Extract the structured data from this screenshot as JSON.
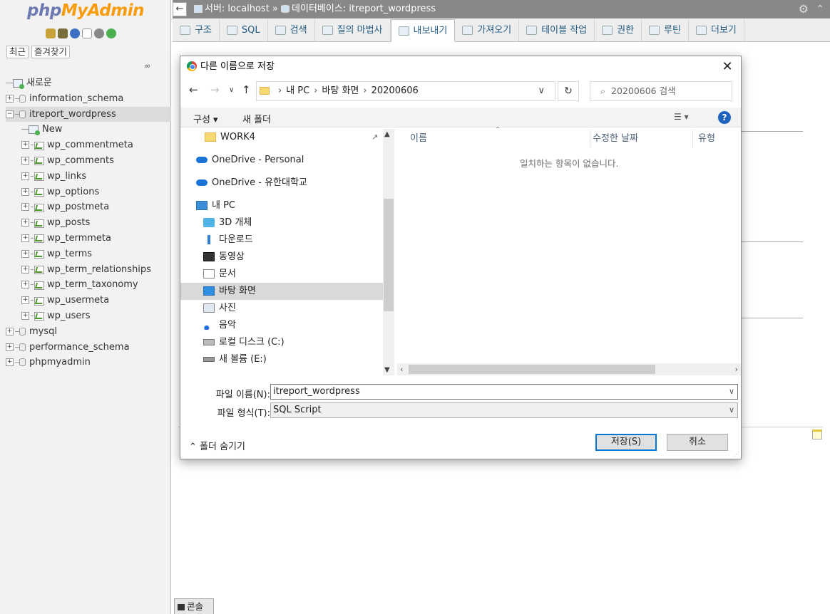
{
  "app": {
    "logo_part1": "php",
    "logo_part2": "MyAdmin",
    "nav_tabs": [
      "최근",
      "즐겨찾기"
    ],
    "nav_icons": [
      "home-icon",
      "exit-icon",
      "help-icon",
      "docs-icon",
      "settings-icon",
      "reload-icon"
    ]
  },
  "tree": {
    "new_label": "새로운",
    "databases_top": [
      "information_schema"
    ],
    "active_db": "itreport_wordpress",
    "active_new": "New",
    "tables": [
      "wp_commentmeta",
      "wp_comments",
      "wp_links",
      "wp_options",
      "wp_postmeta",
      "wp_posts",
      "wp_termmeta",
      "wp_terms",
      "wp_term_relationships",
      "wp_term_taxonomy",
      "wp_usermeta",
      "wp_users"
    ],
    "databases_bottom": [
      "mysql",
      "performance_schema",
      "phpmyadmin"
    ]
  },
  "breadcrumb": {
    "server_label": "서버: localhost",
    "separator": "»",
    "db_label": "데이터베이스: itreport_wordpress"
  },
  "tabs": [
    {
      "label": "구조",
      "icon": "structure-icon"
    },
    {
      "label": "SQL",
      "icon": "sql-icon"
    },
    {
      "label": "검색",
      "icon": "search-icon"
    },
    {
      "label": "질의 마법사",
      "icon": "query-icon"
    },
    {
      "label": "내보내기",
      "icon": "export-icon",
      "active": true
    },
    {
      "label": "가져오기",
      "icon": "import-icon"
    },
    {
      "label": "테이블 작업",
      "icon": "operations-icon"
    },
    {
      "label": "권한",
      "icon": "privileges-icon"
    },
    {
      "label": "루틴",
      "icon": "routines-icon"
    },
    {
      "label": "더보기",
      "icon": "more-icon"
    }
  ],
  "console": {
    "label": "콘솔"
  },
  "dialog": {
    "title": "다른 이름으로 저장",
    "path": [
      "내 PC",
      "바탕 화면",
      "20200606"
    ],
    "search_placeholder": "20200606 검색",
    "organize": "구성 ▾",
    "new_folder": "새 폴더",
    "help": "?",
    "nav_items": [
      {
        "label": "WORK4",
        "icon": "folder-icon"
      },
      {
        "label": "OneDrive - Personal",
        "icon": "cloud-icon"
      },
      {
        "label": "OneDrive - 유한대학교",
        "icon": "cloud-icon"
      },
      {
        "label": "내 PC",
        "icon": "pc-icon"
      },
      {
        "label": "3D 개체",
        "icon": "3d-icon"
      },
      {
        "label": "다운로드",
        "icon": "download-icon"
      },
      {
        "label": "동영상",
        "icon": "video-icon"
      },
      {
        "label": "문서",
        "icon": "document-icon"
      },
      {
        "label": "바탕 화면",
        "icon": "desktop-icon",
        "selected": true
      },
      {
        "label": "사진",
        "icon": "pictures-icon"
      },
      {
        "label": "음악",
        "icon": "music-icon"
      },
      {
        "label": "로컬 디스크 (C:)",
        "icon": "disk-icon"
      },
      {
        "label": "새 볼륨 (E:)",
        "icon": "drive-icon"
      }
    ],
    "columns": [
      "이름",
      "수정한 날짜",
      "유형"
    ],
    "empty_message": "일치하는 항목이 없습니다.",
    "filename_label": "파일 이름(N):",
    "filename_value": "itreport_wordpress",
    "filetype_label": "파일 형식(T):",
    "filetype_value": "SQL Script",
    "hide_folders": "폴더 숨기기",
    "save": "저장(S)",
    "cancel": "취소"
  }
}
